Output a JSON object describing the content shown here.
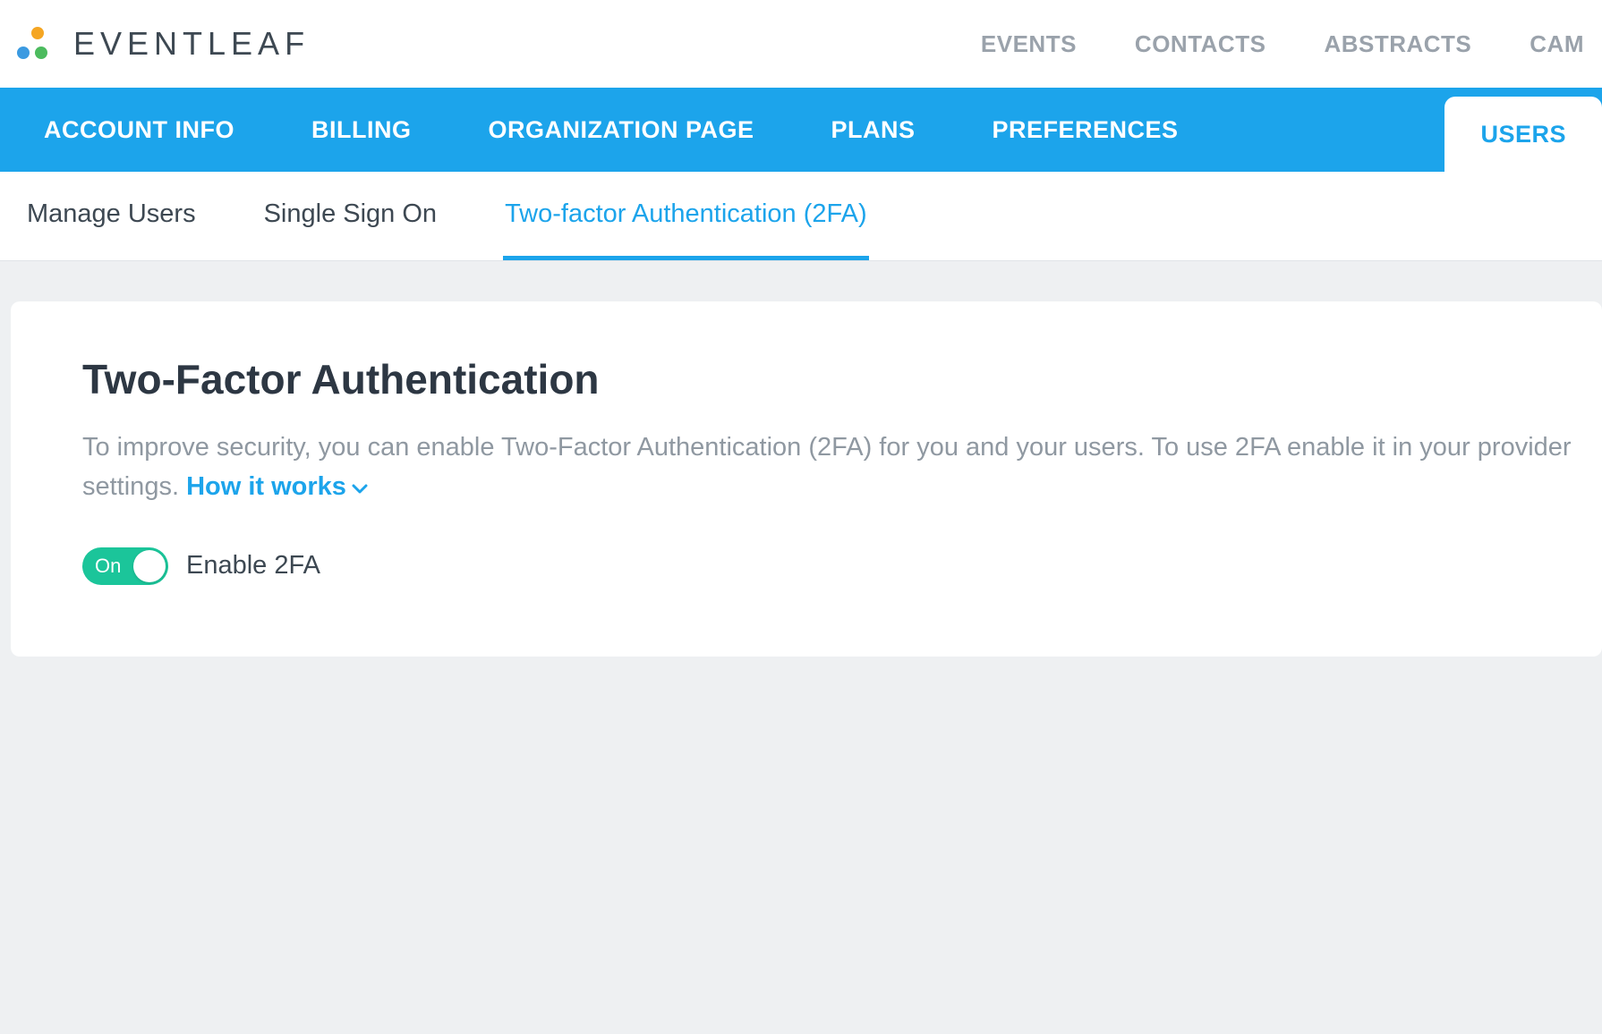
{
  "brand": "EVENTLEAF",
  "top_nav": {
    "items": [
      "EVENTS",
      "CONTACTS",
      "ABSTRACTS",
      "CAM"
    ]
  },
  "sub_nav": {
    "items": [
      {
        "label": "ACCOUNT INFO",
        "active": false
      },
      {
        "label": "BILLING",
        "active": false
      },
      {
        "label": "ORGANIZATION PAGE",
        "active": false
      },
      {
        "label": "PLANS",
        "active": false
      },
      {
        "label": "PREFERENCES",
        "active": false
      },
      {
        "label": "USERS",
        "active": true
      }
    ]
  },
  "tertiary_nav": {
    "items": [
      {
        "label": "Manage Users",
        "active": false
      },
      {
        "label": "Single Sign On",
        "active": false
      },
      {
        "label": "Two-factor Authentication (2FA)",
        "active": true
      }
    ]
  },
  "card": {
    "title": "Two-Factor Authentication",
    "description_part1": "To improve security, you can enable Two-Factor Authentication (2FA) for you and your users. To use 2FA enable it in your provider settings. ",
    "how_link": "How it works",
    "toggle": {
      "state_label": "On",
      "text": "Enable 2FA",
      "on": true
    }
  }
}
